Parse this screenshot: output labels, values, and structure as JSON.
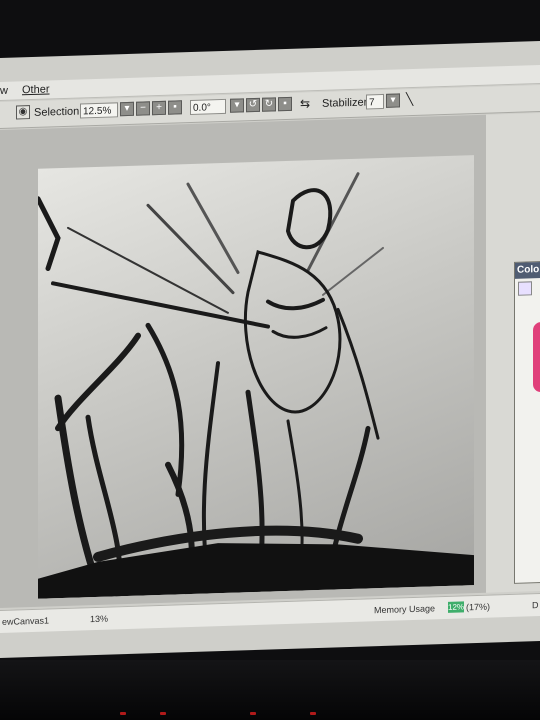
{
  "menu": {
    "partial_left": "w",
    "other": "Other"
  },
  "toolbar": {
    "selection_label": "Selection",
    "zoom_value": "12.5%",
    "rotation_value": "0.0°",
    "stabilizer_label": "Stabilizer",
    "stabilizer_value": "7",
    "zoom_minus": "−",
    "zoom_plus": "+"
  },
  "color_panel": {
    "title": "Colo"
  },
  "status": {
    "canvas_name": "ewCanvas1",
    "canvas_zoom": "13%",
    "memory_label": "Memory Usage",
    "memory_value": "12%",
    "memory_percent": "(17%)",
    "right_partial": "D"
  },
  "colors": {
    "title_bar": "#4f5c72",
    "memory_fill": "#3fae6b"
  }
}
